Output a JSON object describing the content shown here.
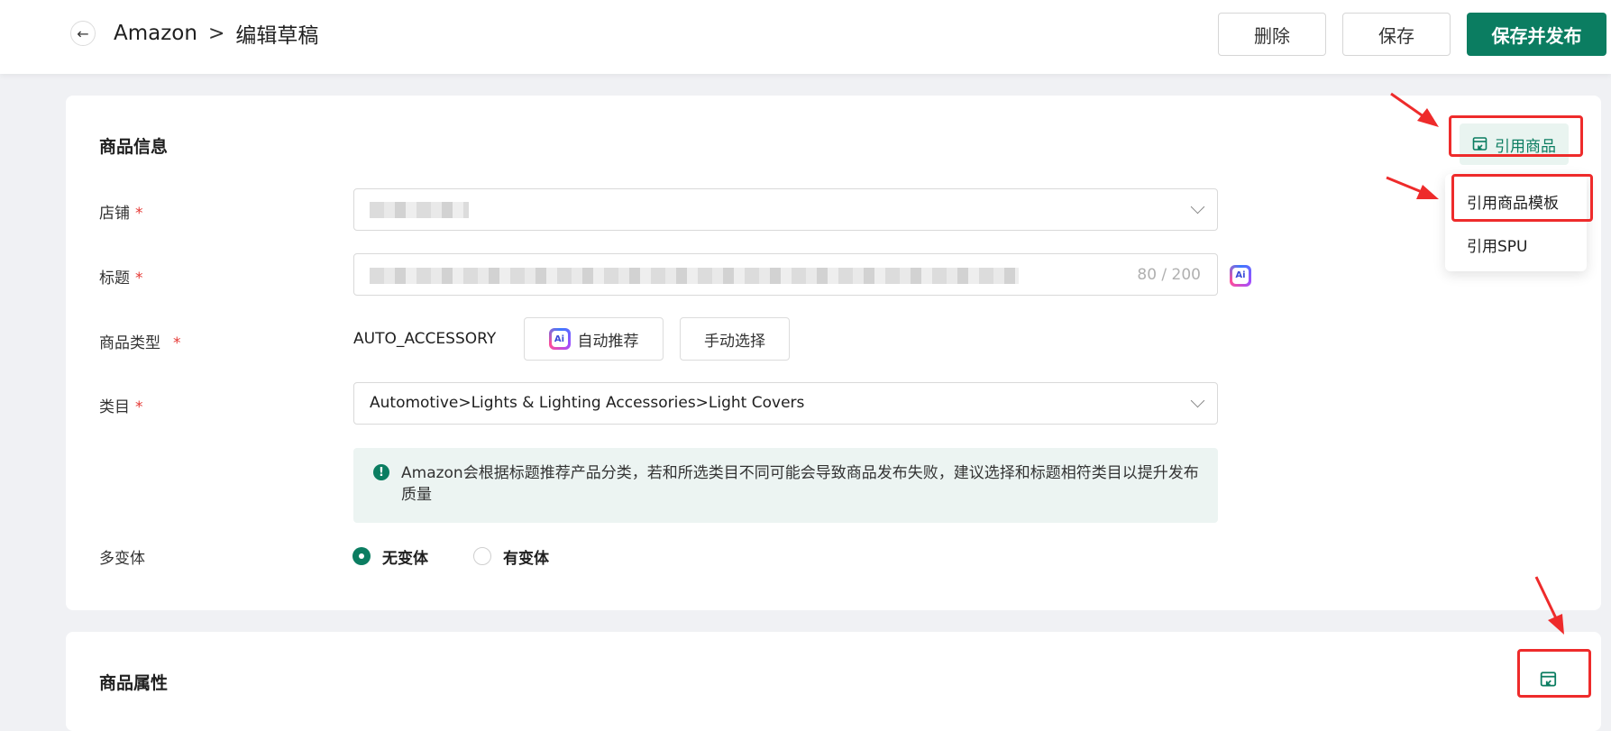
{
  "header": {
    "back_icon": "arrow-left-icon",
    "breadcrumb_root": "Amazon",
    "breadcrumb_sep": ">",
    "breadcrumb_current": "编辑草稿",
    "delete_label": "删除",
    "save_label": "保存",
    "publish_label": "保存并发布"
  },
  "product_info": {
    "title": "商品信息",
    "cite_button": "引用商品",
    "cite_menu": [
      "引用商品模板",
      "引用SPU"
    ],
    "store_label": "店铺",
    "title_label": "标题",
    "title_counter": "80 / 200",
    "type_label": "商品类型",
    "type_value": "AUTO_ACCESSORY",
    "auto_recommend": "自动推荐",
    "manual_select": "手动选择",
    "category_label": "类目",
    "category_value": "Automotive>Lights & Lighting Accessories>Light Covers",
    "notice": "Amazon会根据标题推荐产品分类，若和所选类目不同可能会导致商品发布失败，建议选择和标题相符类目以提升发布质量",
    "variant_label": "多变体",
    "variant_options": [
      "无变体",
      "有变体"
    ],
    "variant_selected": "无变体",
    "required_mark": "*",
    "ai_badge": "Ai"
  },
  "attributes": {
    "title": "商品属性"
  },
  "colors": {
    "primary": "#0b7d61",
    "required": "#e53935",
    "highlight": "#ee2b2b"
  }
}
